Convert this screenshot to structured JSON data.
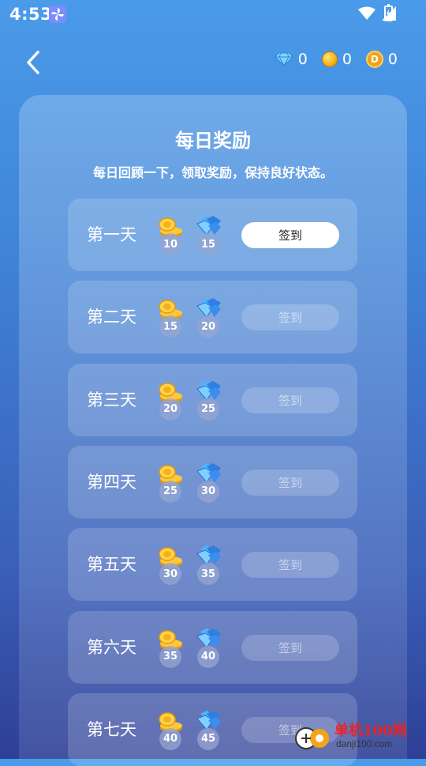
{
  "status_bar": {
    "time": "4:53"
  },
  "header": {
    "currencies": [
      {
        "icon": "diamond-icon",
        "value": "0"
      },
      {
        "icon": "gold-coin-icon",
        "value": "0"
      },
      {
        "icon": "d-coin-icon",
        "letter": "D",
        "value": "0"
      }
    ]
  },
  "main": {
    "title": "每日奖励",
    "subtitle": "每日回顾一下，领取奖励，保持良好状态。",
    "days": [
      {
        "label": "第一天",
        "coins": "10",
        "gems": "15",
        "button": "签到",
        "state": "active"
      },
      {
        "label": "第二天",
        "coins": "15",
        "gems": "20",
        "button": "签到",
        "state": "disabled"
      },
      {
        "label": "第三天",
        "coins": "20",
        "gems": "25",
        "button": "签到",
        "state": "disabled"
      },
      {
        "label": "第四天",
        "coins": "25",
        "gems": "30",
        "button": "签到",
        "state": "disabled"
      },
      {
        "label": "第五天",
        "coins": "30",
        "gems": "35",
        "button": "签到",
        "state": "disabled"
      },
      {
        "label": "第六天",
        "coins": "35",
        "gems": "40",
        "button": "签到",
        "state": "disabled"
      },
      {
        "label": "第七天",
        "coins": "40",
        "gems": "45",
        "button": "签到",
        "state": "disabled"
      }
    ]
  },
  "watermark": {
    "brand": "单机100网",
    "domain": "danji100.com"
  },
  "colors": {
    "bg_top": "#4a9bea",
    "bg_bottom": "#2e3f96",
    "button_active": "#ffffff",
    "watermark_red": "#e22222"
  }
}
